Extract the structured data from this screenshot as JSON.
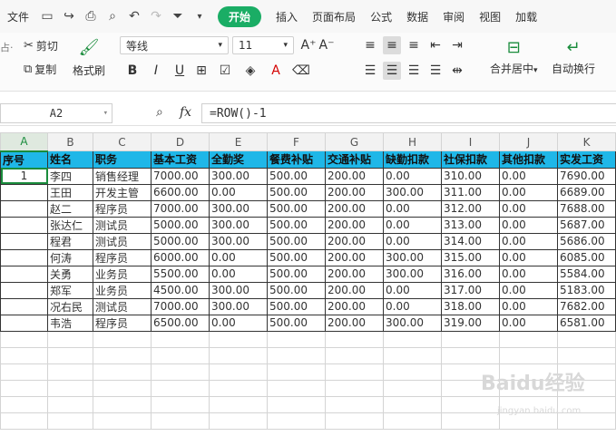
{
  "menubar": {
    "file": "文件",
    "tabs": [
      "开始",
      "插入",
      "页面布局",
      "公式",
      "数据",
      "审阅",
      "视图",
      "加载"
    ]
  },
  "ribbon": {
    "cut": "剪切",
    "copy": "复制",
    "format_painter": "格式刷",
    "paste_partial": "占·",
    "font_name": "等线",
    "font_size": "11",
    "merge_center": "合并居中",
    "wrap_text": "自动换行"
  },
  "formula_bar": {
    "cell_ref": "A2",
    "fx": "fx",
    "formula": "=ROW()-1"
  },
  "sheet": {
    "columns": [
      "A",
      "B",
      "C",
      "D",
      "E",
      "F",
      "G",
      "H",
      "I",
      "J",
      "K"
    ],
    "header": [
      "序号",
      "姓名",
      "职务",
      "基本工资",
      "全勤奖",
      "餐费补贴",
      "交通补贴",
      "缺勤扣款",
      "社保扣款",
      "其他扣款",
      "实发工资"
    ],
    "rows": [
      [
        "1",
        "李四",
        "销售经理",
        "7000.00",
        "300.00",
        "500.00",
        "200.00",
        "0.00",
        "310.00",
        "0.00",
        "7690.00"
      ],
      [
        "",
        "王田",
        "开发主管",
        "6600.00",
        "0.00",
        "500.00",
        "200.00",
        "300.00",
        "311.00",
        "0.00",
        "6689.00"
      ],
      [
        "",
        "赵二",
        "程序员",
        "7000.00",
        "300.00",
        "500.00",
        "200.00",
        "0.00",
        "312.00",
        "0.00",
        "7688.00"
      ],
      [
        "",
        "张达仁",
        "测试员",
        "5000.00",
        "300.00",
        "500.00",
        "200.00",
        "0.00",
        "313.00",
        "0.00",
        "5687.00"
      ],
      [
        "",
        "程君",
        "测试员",
        "5000.00",
        "300.00",
        "500.00",
        "200.00",
        "0.00",
        "314.00",
        "0.00",
        "5686.00"
      ],
      [
        "",
        "何涛",
        "程序员",
        "6000.00",
        "0.00",
        "500.00",
        "200.00",
        "300.00",
        "315.00",
        "0.00",
        "6085.00"
      ],
      [
        "",
        "关勇",
        "业务员",
        "5500.00",
        "0.00",
        "500.00",
        "200.00",
        "300.00",
        "316.00",
        "0.00",
        "5584.00"
      ],
      [
        "",
        "郑军",
        "业务员",
        "4500.00",
        "300.00",
        "500.00",
        "200.00",
        "0.00",
        "317.00",
        "0.00",
        "5183.00"
      ],
      [
        "",
        "况右民",
        "测试员",
        "7000.00",
        "300.00",
        "500.00",
        "200.00",
        "0.00",
        "318.00",
        "0.00",
        "7682.00"
      ],
      [
        "",
        "韦浩",
        "程序员",
        "6500.00",
        "0.00",
        "500.00",
        "200.00",
        "300.00",
        "319.00",
        "0.00",
        "6581.00"
      ]
    ]
  },
  "watermark": "Baidu经验",
  "watermark_sub": "jingyan.baidu.com"
}
